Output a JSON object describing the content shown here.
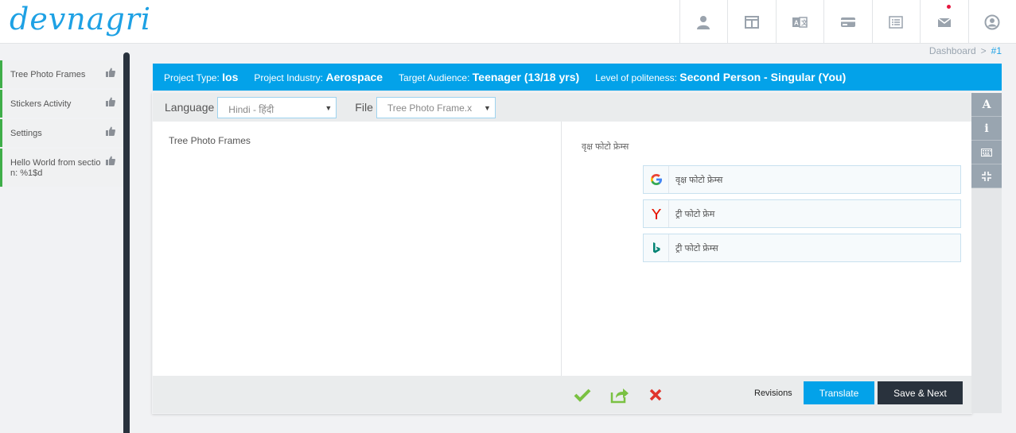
{
  "app": {
    "logo_text": "devnagri"
  },
  "topbar": {
    "icons": [
      "user-icon",
      "layout-icon",
      "translate-icon",
      "card-icon",
      "list-icon",
      "mail-icon",
      "profile-icon"
    ],
    "notification_color": "#e5173f"
  },
  "sidebar": {
    "items": [
      {
        "label": "Tree Photo Frames"
      },
      {
        "label": "Stickers Activity"
      },
      {
        "label": "Settings"
      },
      {
        "label": "Hello World from section: %1$d"
      }
    ]
  },
  "breadcrumb": {
    "home": "Dashboard",
    "separator": ">",
    "current": "#1"
  },
  "project": {
    "type_label": "Project Type:",
    "type_value": "Ios",
    "industry_label": "Project Industry:",
    "industry_value": "Aerospace",
    "audience_label": "Target Audience:",
    "audience_value": "Teenager (13/18 yrs)",
    "politeness_label": "Level of politeness:",
    "politeness_value": "Second Person - Singular (You)"
  },
  "filters": {
    "language_label": "Language",
    "language_value": "Hindi - हिंदी",
    "file_label": "File",
    "file_value": "Tree Photo Frame.x"
  },
  "editor": {
    "source_text": "Tree Photo Frames",
    "target_text": "वृक्ष फोटो फ्रेम्स",
    "suggestions": [
      {
        "engine": "google-icon",
        "text": "वृक्ष फोटो फ्रेम्स"
      },
      {
        "engine": "yandex-icon",
        "text": "ट्री फोटो फ्रेम"
      },
      {
        "engine": "bing-icon",
        "text": "ट्री फोटो फ्रेम्स"
      }
    ]
  },
  "tools": [
    {
      "icon": "font-icon",
      "glyph": "A"
    },
    {
      "icon": "info-icon",
      "glyph": "i"
    },
    {
      "icon": "keyboard-icon",
      "glyph": ""
    },
    {
      "icon": "compress-icon",
      "glyph": ""
    }
  ],
  "actions": {
    "accept_icon": "check-icon",
    "share_icon": "share-icon",
    "reject_icon": "close-icon",
    "revisions_label": "Revisions",
    "translate_label": "Translate",
    "save_next_label": "Save & Next"
  },
  "colors": {
    "accent": "#03a2e9",
    "dark": "#29323d",
    "sidebar_active": "#3fae49",
    "check": "#7ac142",
    "reject": "#e0342b"
  }
}
